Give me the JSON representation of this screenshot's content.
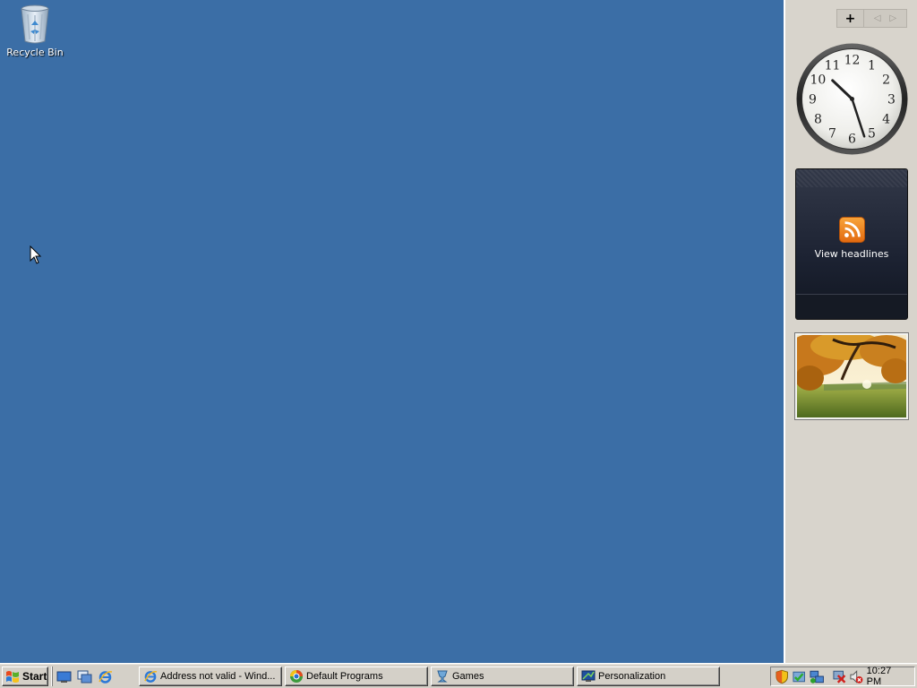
{
  "desktop": {
    "icons": [
      {
        "label": "Recycle Bin",
        "icon": "recycle-bin-icon"
      }
    ],
    "background_color": "#3b6ea6"
  },
  "sidebar": {
    "add_button_label": "+",
    "prev_icon": "triangle-left-icon",
    "next_icon": "triangle-right-icon",
    "clock": {
      "numbers": [
        "12",
        "1",
        "2",
        "3",
        "4",
        "5",
        "6",
        "7",
        "8",
        "9",
        "10",
        "11"
      ],
      "time": "10:27"
    },
    "feed": {
      "label": "View headlines",
      "icon": "rss-feed-icon",
      "accent": "#f08a24"
    },
    "slideshow": {
      "subject": "autumn-tree-photo"
    }
  },
  "taskbar": {
    "start_label": "Start",
    "quick_launch": [
      {
        "name": "show-desktop-icon"
      },
      {
        "name": "switch-windows-icon"
      },
      {
        "name": "internet-explorer-icon"
      }
    ],
    "tasks": [
      {
        "label": "Address not valid - Wind...",
        "icon": "internet-explorer-icon"
      },
      {
        "label": "Default Programs",
        "icon": "default-programs-icon"
      },
      {
        "label": "Games",
        "icon": "games-icon"
      },
      {
        "label": "Personalization",
        "icon": "personalization-icon"
      }
    ],
    "tray": {
      "icons": [
        "security-shield-icon",
        "windows-defender-icon",
        "network-icon",
        "network-error-icon",
        "volume-muted-icon"
      ],
      "time": "10:27 PM"
    }
  }
}
